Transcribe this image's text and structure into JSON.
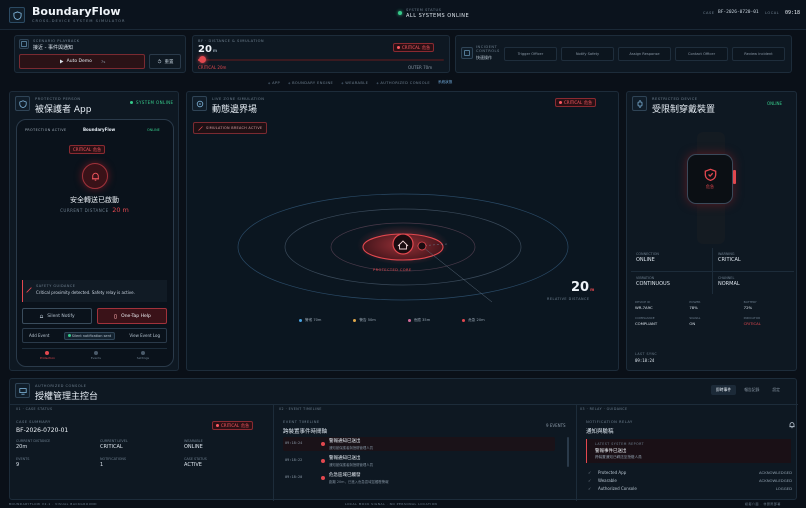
{
  "app": {
    "title": "BoundaryFlow",
    "subtitle": "CROSS-DEVICE SYSTEM SIMULATOR"
  },
  "status": {
    "label": "SYSTEM STATUS",
    "value": "ALL SYSTEMS ONLINE",
    "case_label": "CASE",
    "case_id": "BF-2026-0720-01",
    "local_label": "LOCAL",
    "local_time": "09:18"
  },
  "scenario": {
    "label": "SCENARIO PLAYBACK",
    "value": "接近 - 事件與通知",
    "auto_demo": "Auto Demo",
    "auto_demo_key": "7s",
    "reset": "重置"
  },
  "distance": {
    "label": "BF · DISTANCE & SIMULATION",
    "value": "20",
    "unit": "m",
    "chip": "CRITICAL",
    "chip_cn": "危急",
    "level_critical": "CRITICAL 20m",
    "level_outer": "OUTER 70m",
    "fill_fraction": 0.03
  },
  "incident": {
    "label": "INCIDENT CONTROLS",
    "sub": "快速操作",
    "buttons": [
      "Trigger Officer",
      "Notify Safety",
      "Assign Response",
      "Contact Officer",
      "Review incident"
    ]
  },
  "nav": {
    "items": [
      "APP",
      "BOUNDARY ENGINE",
      "WEARABLE",
      "AUTHORIZED CONSOLE"
    ],
    "active": "系統狀態"
  },
  "protected_app": {
    "label": "PROTECTED PERSON",
    "title": "被保護者 App",
    "status": "SYSTEM ONLINE",
    "phone": {
      "left": "PROTECTION ACTIVE",
      "brand": "BoundaryFlow",
      "online": "ONLINE",
      "chip": "CRITICAL",
      "chip_cn": "危急",
      "heading": "安全轉送已啟動",
      "distance_label": "CURRENT DISTANCE",
      "distance_value": "20 m",
      "guidance_label": "SAFETY GUIDANCE",
      "guidance_text": "Critical proximity detected. Safety relay is active.",
      "silent_notify": "Silent Notify",
      "one_tap": "One-Tap Help",
      "add_event": "Add Event",
      "tag": "Silent notification sent",
      "view_log": "View Event Log",
      "tabs": [
        "Protection",
        "Events",
        "Settings"
      ]
    }
  },
  "zone": {
    "label": "LIVE ZONE SIMULATION",
    "title": "動態邊界場",
    "chip": "CRITICAL",
    "chip_cn": "危急",
    "sim_btn": "SIMULATION BREACH ACTIVE",
    "core_label": "PROTECTED CORE",
    "distance": "20",
    "distance_unit": "m",
    "distance_label": "RELATIVE DISTANCE",
    "legend": [
      {
        "label": "警戒 70m",
        "color": "#4aa3e0"
      },
      {
        "label": "警告 50m",
        "color": "#e0a84a"
      },
      {
        "label": "危險 35m",
        "color": "#d36a9a"
      },
      {
        "label": "危急 20m",
        "color": "#e2484f"
      }
    ]
  },
  "wearable": {
    "label": "RESTRICTED DEVICE",
    "title": "受限制穿戴裝置",
    "status": "ONLINE",
    "watch_text": "危急",
    "stats": [
      {
        "k": "CONNECTION",
        "v": "ONLINE",
        "cls": "green"
      },
      {
        "k": "WARNING",
        "v": "CRITICAL",
        "cls": "red"
      },
      {
        "k": "VIBRATION",
        "v": "CONTINUOUS",
        "cls": ""
      },
      {
        "k": "CHANNEL",
        "v": "NORMAL",
        "cls": ""
      }
    ],
    "meta": [
      {
        "k": "DEVICE ID",
        "v": "WR-7A9C"
      },
      {
        "k": "POWER",
        "v": "78%"
      },
      {
        "k": "BATTERY",
        "v": "72%"
      },
      {
        "k": "COMPLIANCE",
        "v": "COMPLIANT"
      },
      {
        "k": "SIGNAL",
        "v": "ON"
      },
      {
        "k": "INDICATOR",
        "v": "CRITICAL"
      }
    ],
    "last_sync_label": "LAST SYNC",
    "last_sync": "09:18:24"
  },
  "console": {
    "label": "AUTHORIZED CONSOLE",
    "title": "授權管理主控台",
    "tabs": [
      "即時事件",
      "報告記錄",
      "設定"
    ],
    "case": {
      "label": "01 · CASE STATUS",
      "summary_label": "CASE SUMMARY",
      "case_id": "BF-2026-0720-01",
      "chip": "CRITICAL",
      "chip_cn": "危急",
      "fields": [
        {
          "k": "CURRENT DISTANCE",
          "v": "20m",
          "cls": ""
        },
        {
          "k": "CURRENT LEVEL",
          "v": "CRITICAL",
          "cls": "red"
        },
        {
          "k": "WEARABLE",
          "v": "ONLINE",
          "cls": "green"
        },
        {
          "k": "EVENTS",
          "v": "9",
          "cls": ""
        },
        {
          "k": "NOTIFICATIONS",
          "v": "1",
          "cls": ""
        },
        {
          "k": "CASE STATUS",
          "v": "ACTIVE",
          "cls": ""
        }
      ]
    },
    "timeline": {
      "label": "02 · EVENT TIMELINE",
      "title": "EVENT TIMELINE",
      "sub": "跨裝置事件時間軸",
      "count": "9 EVENTS",
      "events": [
        {
          "time": "09:18:24",
          "title": "警報通知已送出",
          "desc": "通知被保護者與授權管理人員"
        },
        {
          "time": "09:18:22",
          "title": "警報通知已送出",
          "desc": "通知被保護者與授權管理人員"
        },
        {
          "time": "09:18:20",
          "title": "危急區域已觸發",
          "desc": "距離 20m，已進入危急區域並觸發警報"
        }
      ]
    },
    "relay": {
      "label": "03 · RELAY · GUIDANCE",
      "title": "NOTIFICATION RELAY",
      "sub": "通知與驗稿",
      "report_label": "LATEST SYSTEM REPORT",
      "report_title": "警報事件已送出",
      "report_desc": "跨裝置通知已轉送至授權人員",
      "rows": [
        {
          "name": "Protected App",
          "status": "ACKNOWLEDGED"
        },
        {
          "name": "Wearable",
          "status": "ACKNOWLEDGED"
        },
        {
          "name": "Authorized Console",
          "status": "LOGGED"
        }
      ]
    }
  },
  "footer": {
    "left": "BOUNDARYFLOW V2.1 · VISUAL BACKGROUND",
    "center": "LOCAL MOCK SIGNAL · NO PERSONAL LOCATION",
    "right": "模擬介面 · 非實際部署"
  }
}
